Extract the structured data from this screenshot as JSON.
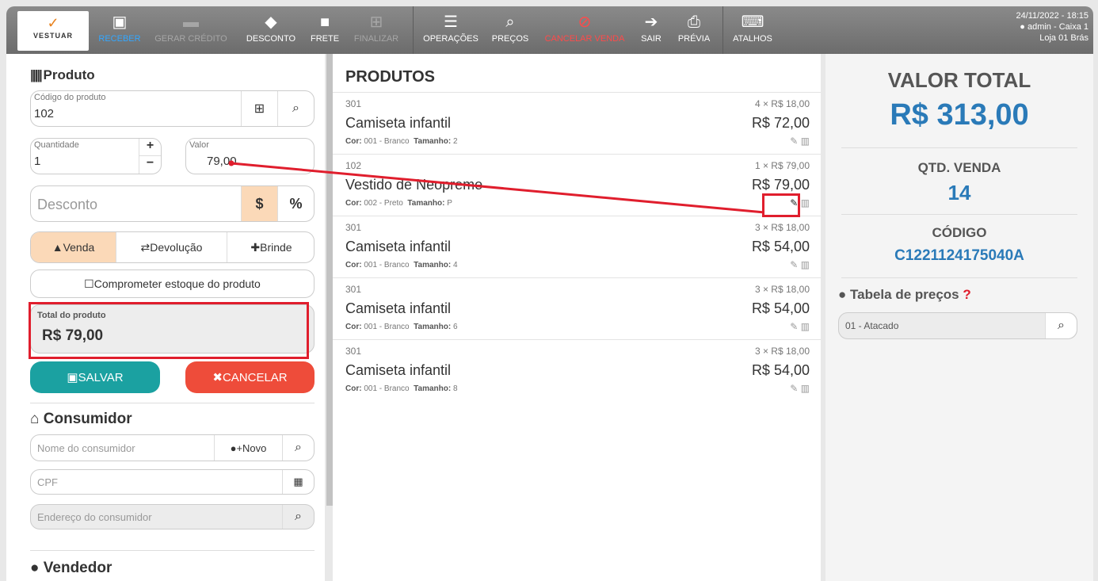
{
  "logo": {
    "check": "✓",
    "text": "VESTUAR"
  },
  "toolbar": [
    {
      "label": "RECEBER",
      "icon": "cash-icon"
    },
    {
      "label": "GERAR CRÉDITO",
      "icon": "card-icon"
    },
    {
      "label": "DESCONTO",
      "icon": "tags-icon"
    },
    {
      "label": "FRETE",
      "icon": "truck-icon"
    },
    {
      "label": "FINALIZAR",
      "icon": "cart-icon"
    },
    {
      "label": "OPERAÇÕES",
      "icon": "menu-icon"
    },
    {
      "label": "PREÇOS",
      "icon": "search-icon"
    },
    {
      "label": "CANCELAR VENDA",
      "icon": "ban-icon"
    },
    {
      "label": "SAIR",
      "icon": "sign-out-icon"
    },
    {
      "label": "PRÉVIA",
      "icon": "printer-icon"
    },
    {
      "label": "ATALHOS",
      "icon": "keyboard-icon"
    }
  ],
  "header_info": {
    "datetime": "24/11/2022 - 18:15",
    "user": "admin - Caixa 1",
    "store": "Loja 01 Brás"
  },
  "produto": {
    "title": "Produto",
    "codigo_label": "Código do produto",
    "codigo_value": "102",
    "quantidade_label": "Quantidade",
    "quantidade_value": "1",
    "valor_label": "Valor",
    "valor_value": "79,00",
    "desconto_placeholder": "Desconto",
    "desc_currency": "$",
    "desc_percent": "%",
    "modes": [
      "Venda",
      "Devolução",
      "Brinde"
    ],
    "active_mode": "Venda",
    "comprometer_label": "Comprometer estoque do produto",
    "total_label": "Total do produto",
    "total_value": "R$ 79,00",
    "save_label": "SALVAR",
    "cancel_label": "CANCELAR"
  },
  "consumidor": {
    "title": "Consumidor",
    "nome_placeholder": "Nome do consumidor",
    "novo_label": "Novo",
    "cpf_placeholder": "CPF",
    "endereco_placeholder": "Endereço do consumidor"
  },
  "vendedor": {
    "title": "Vendedor"
  },
  "produtos": {
    "title": "PRODUTOS",
    "items": [
      {
        "code": "301",
        "name": "Camiseta infantil",
        "cor_label": "Cor:",
        "cor": "001 - Branco",
        "tam_label": "Tamanho:",
        "tamanho": "2",
        "qty": "4 × R$ 18,00",
        "total": "R$ 72,00"
      },
      {
        "code": "102",
        "name": "Vestido de Neopreme",
        "cor_label": "Cor:",
        "cor": "002 - Preto",
        "tam_label": "Tamanho:",
        "tamanho": "P",
        "qty": "1 × R$ 79,00",
        "total": "R$ 79,00"
      },
      {
        "code": "301",
        "name": "Camiseta infantil",
        "cor_label": "Cor:",
        "cor": "001 - Branco",
        "tam_label": "Tamanho:",
        "tamanho": "4",
        "qty": "3 × R$ 18,00",
        "total": "R$ 54,00"
      },
      {
        "code": "301",
        "name": "Camiseta infantil",
        "cor_label": "Cor:",
        "cor": "001 - Branco",
        "tam_label": "Tamanho:",
        "tamanho": "6",
        "qty": "3 × R$ 18,00",
        "total": "R$ 54,00"
      },
      {
        "code": "301",
        "name": "Camiseta infantil",
        "cor_label": "Cor:",
        "cor": "001 - Branco",
        "tam_label": "Tamanho:",
        "tamanho": "8",
        "qty": "3 × R$ 18,00",
        "total": "R$ 54,00"
      }
    ]
  },
  "resumo": {
    "valor_total_label": "VALOR TOTAL",
    "valor_total": "R$ 313,00",
    "qtd_label": "QTD. VENDA",
    "qtd": "14",
    "codigo_label": "CÓDIGO",
    "codigo": "C1221124175040A",
    "tabela_label": "Tabela de preços",
    "tabela_help": "?",
    "tabela_value": "01 - Atacado"
  },
  "colors": {
    "accent_blue": "#2a7ab8",
    "orange_soft": "#fbd9b8",
    "teal": "#1ba1a1",
    "red": "#ee4c3a",
    "highlight_red": "#e01e2d"
  }
}
